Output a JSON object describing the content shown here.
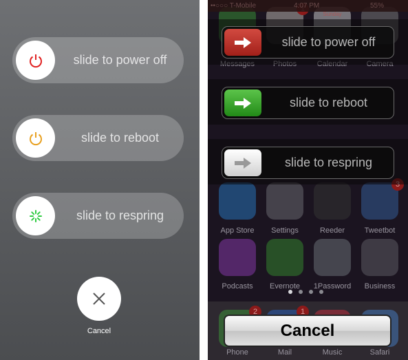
{
  "left": {
    "sliders": [
      {
        "label": "slide to power off",
        "icon": "power-icon",
        "color": "#e02020"
      },
      {
        "label": "slide to reboot",
        "icon": "power-icon",
        "color": "#e8a020"
      },
      {
        "label": "slide to respring",
        "icon": "spinner-icon",
        "color": "#2ecc40"
      }
    ],
    "cancel_label": "Cancel"
  },
  "right": {
    "status": {
      "carrier": "••○○○ T-Mobile",
      "time": "4:07 PM",
      "battery": "55%"
    },
    "sliders": [
      {
        "label": "slide to power off",
        "icon": "arrow-right-icon",
        "color": "#b52a22"
      },
      {
        "label": "slide to reboot",
        "icon": "arrow-right-icon",
        "color": "#2f9e24"
      },
      {
        "label": "slide to respring",
        "icon": "arrow-right-icon",
        "color": "#e8e8e8"
      }
    ],
    "apps": [
      {
        "label": "Messages",
        "color": "#3fa33a"
      },
      {
        "label": "Photos",
        "color": "#d8d0c8",
        "badge": "1"
      },
      {
        "label": "Calendar",
        "color": "#e8e8e8",
        "sublabel": "Sunday"
      },
      {
        "label": "Camera",
        "color": "#8a8a8a"
      },
      {
        "label": "App Store",
        "color": "#2a86d8"
      },
      {
        "label": "Settings",
        "color": "#7a7a80"
      },
      {
        "label": "Reeder",
        "color": "#3a3a38"
      },
      {
        "label": "Tweetbot",
        "color": "#3a6ab0",
        "badge": "3"
      },
      {
        "label": "Podcasts",
        "color": "#9a3fc0"
      },
      {
        "label": "Evernote",
        "color": "#3a9a30"
      },
      {
        "label": "1Password",
        "color": "#7a8088"
      },
      {
        "label": "Business",
        "color": "#6a6870"
      }
    ],
    "dock": [
      {
        "label": "Phone",
        "color": "#3fa33a",
        "badge": "2"
      },
      {
        "label": "Mail",
        "color": "#2a6ad0",
        "badge": "1"
      },
      {
        "label": "Music",
        "color": "#d83040"
      },
      {
        "label": "Safari",
        "color": "#4a8ad8"
      }
    ],
    "page_count": 4,
    "current_page": 1,
    "cancel_label": "Cancel"
  }
}
